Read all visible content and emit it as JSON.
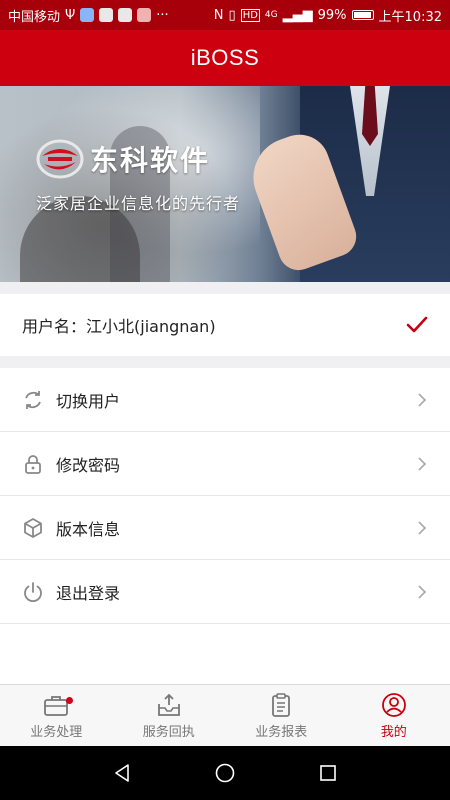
{
  "status_bar": {
    "carrier": "中国移动",
    "usb_symbol": "Ψ",
    "more": "···",
    "nfc": "N",
    "hd": "HD",
    "network": "4G",
    "battery": "99%",
    "time": "上午10:32"
  },
  "header": {
    "title": "iBOSS"
  },
  "banner": {
    "brand_name": "东科软件",
    "slogan": "泛家居企业信息化的先行者"
  },
  "user": {
    "label": "用户名：江小北(jiangnan)"
  },
  "menu": {
    "items": [
      {
        "label": "切换用户",
        "icon": "refresh-icon"
      },
      {
        "label": "修改密码",
        "icon": "lock-icon"
      },
      {
        "label": "版本信息",
        "icon": "cube-icon"
      },
      {
        "label": "退出登录",
        "icon": "power-icon"
      }
    ]
  },
  "tabbar": {
    "tabs": [
      {
        "label": "业务处理",
        "icon": "briefcase-icon",
        "badge": true
      },
      {
        "label": "服务回执",
        "icon": "inbox-upload-icon"
      },
      {
        "label": "业务报表",
        "icon": "clipboard-icon"
      },
      {
        "label": "我的",
        "icon": "user-circle-icon",
        "active": true
      }
    ]
  },
  "colors": {
    "primary": "#cc000f",
    "status_bar": "#a7000b",
    "active_tab": "#c8000f"
  }
}
